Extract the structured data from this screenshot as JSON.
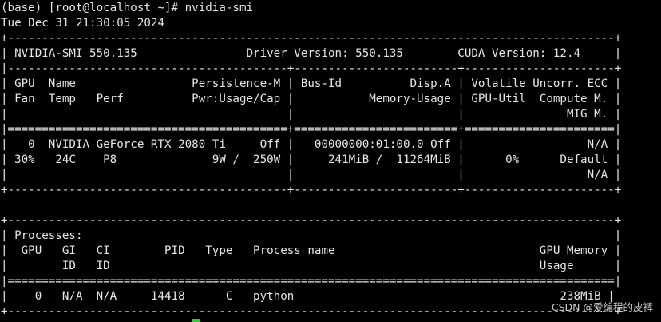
{
  "terminal": {
    "lines": [
      "(base) [root@localhost ~]# nvidia-smi",
      "Tue Dec 31 21:30:05 2024",
      "+-----------------------------------------------------------------------------------------+",
      "| NVIDIA-SMI 550.135                Driver Version: 550.135        CUDA Version: 12.4     |",
      "|-----------------------------------------+------------------------+----------------------+",
      "| GPU  Name                 Persistence-M | Bus-Id          Disp.A | Volatile Uncorr. ECC |",
      "| Fan  Temp   Perf          Pwr:Usage/Cap |           Memory-Usage | GPU-Util  Compute M. |",
      "|                                         |                        |               MIG M. |",
      "|=========================================+========================+======================|",
      "|   0  NVIDIA GeForce RTX 2080 Ti     Off |   00000000:01:00.0 Off |                  N/A |",
      "| 30%   24C    P8              9W /  250W |     241MiB /  11264MiB |      0%      Default |",
      "|                                         |                        |                  N/A |",
      "+-----------------------------------------+------------------------+----------------------+",
      "",
      "+-----------------------------------------------------------------------------------------+",
      "| Processes:                                                                              |",
      "|  GPU   GI   CI        PID   Type   Process name                              GPU Memory |",
      "|        ID   ID                                                               Usage      |",
      "|=========================================================================================|",
      "|    0   N/A  N/A     14418      C   python                                       238MiB |",
      "+-----------------------------------------------------------------------------------------+"
    ]
  },
  "watermark": "CSDN @爱编程的皮裤",
  "colors": {
    "background": "#000000",
    "text": "#e6e6e6",
    "cursor": "#2bd12b"
  }
}
